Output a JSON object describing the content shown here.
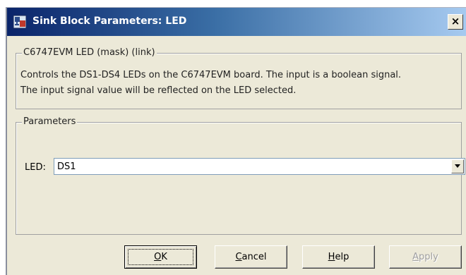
{
  "window": {
    "title": "Sink Block Parameters: LED",
    "close_glyph": "×",
    "icon": "simulink-block-icon"
  },
  "description_group": {
    "legend": "C6747EVM LED (mask) (link)",
    "lines": [
      "Controls the DS1-DS4 LEDs on the C6747EVM board. The input is a boolean signal.",
      "The input signal value will be reflected on the LED selected."
    ]
  },
  "parameters_group": {
    "legend": "Parameters",
    "led_field": {
      "label": "LED:",
      "value": "DS1"
    }
  },
  "buttons": {
    "ok": {
      "mnemonic": "O",
      "rest": "K"
    },
    "cancel": {
      "mnemonic": "C",
      "rest": "ancel"
    },
    "help": {
      "mnemonic": "H",
      "rest": "elp"
    },
    "apply": {
      "mnemonic": "A",
      "rest": "pply",
      "enabled": false
    }
  },
  "colors": {
    "titlebar_start": "#0a246a",
    "titlebar_end": "#a6caf0",
    "dialog_face": "#ece9d8"
  }
}
